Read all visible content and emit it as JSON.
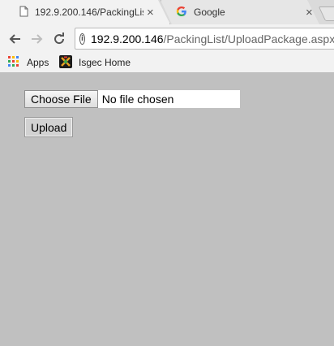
{
  "tabs": [
    {
      "title": "192.9.200.146/PackingLis",
      "favicon": "document-icon",
      "close": "×"
    },
    {
      "title": "Google",
      "favicon": "google-g-icon",
      "close": "×"
    }
  ],
  "toolbar": {
    "back_icon": "back-arrow-icon",
    "forward_icon": "forward-arrow-icon",
    "reload_icon": "reload-icon",
    "info_icon": "i",
    "url_host": "192.9.200.146",
    "url_path": "/PackingList/UploadPackage.aspx?"
  },
  "bookmarks": [
    {
      "label": "Apps",
      "icon": "apps-grid-icon"
    },
    {
      "label": "Isgec Home",
      "icon": "isgec-logo-icon"
    }
  ],
  "form": {
    "choose_file_label": "Choose File",
    "file_status": "No file chosen",
    "upload_label": "Upload"
  },
  "colors": {
    "page_background": "#c0c0c0",
    "chrome_background": "#f2f2f2",
    "tabstrip_background": "#dadada"
  }
}
